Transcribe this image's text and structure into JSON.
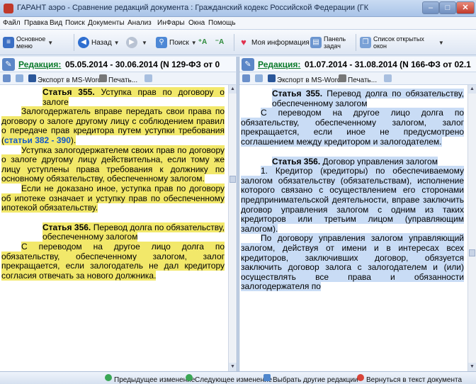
{
  "window": {
    "title": "ГАРАНТ аэро - Сравнение редакций документа : Гражданский кодекс Российской Федерации (ГК РФ) (части перва...",
    "min": "–",
    "max": "□",
    "close": "✕"
  },
  "menu": [
    "Файл",
    "Правка",
    "Вид",
    "Поиск",
    "Документы",
    "Анализ",
    "ИнФары",
    "Окна",
    "Помощь"
  ],
  "toolbar": {
    "main_menu_line1": "Основное",
    "main_menu_line2": "меню",
    "back": "Назад",
    "search": "Поиск",
    "my_info": "Моя информация",
    "panel_line1": "Панель",
    "panel_line2": "задач",
    "windows_line1": "Список открытых",
    "windows_line2": "окон"
  },
  "left": {
    "label": "Редакция:",
    "dates": "05.05.2014 - 30.06.2014 (N 129-ФЗ от 0",
    "export": "Экспорт в MS-Word",
    "print": "Печать...",
    "art355_title": "Статья 355.",
    "art355_name": "Уступка прав по договору о залоге",
    "p1": "Залогодержатель вправе передать свои права по договору о залоге другому лицу с соблюдением правил о передаче прав кредитора путем уступки требования (",
    "p1_link": "статьи 382 - 390",
    "p1_end": ").",
    "p2": "Уступка залогодержателем своих прав по договору о залоге другому лицу действительна, если тому же лицу уступлены права требования к должнику по основному обязательству, обеспеченному залогом.",
    "p3": "Если не доказано иное, уступка прав по договору об ипотеке означает и уступку прав по обеспеченному ипотекой обязательству.",
    "art356_title": "Статья 356.",
    "art356_name": "Перевод долга по обязательству, обеспеченному залогом",
    "p4": "С переводом на другое лицо долга по обязательству, обеспеченному залогом, залог прекращается, если залогодатель не дал кредитору согласия отвечать за нового должника."
  },
  "right": {
    "label": "Редакция:",
    "dates": "01.07.2014 - 31.08.2014 (N 166-ФЗ от 02.1",
    "export": "Экспорт в MS-Word",
    "print": "Печать...",
    "art355_title": "Статья 355.",
    "art355_name": "Перевод долга по обязательству, обеспеченному залогом",
    "p1": "С переводом на другое лицо долга по обязательству, обеспеченному залогом, залог прекращается, если иное не предусмотрено соглашением между кредитором и залогодателем.",
    "art356_title": "Статья 356.",
    "art356_name": "Договор управления залогом",
    "p2": "1. Кредитор (кредиторы) по обеспечиваемому залогом обязательству (обязательствам), исполнение которого связано с осуществлением его сторонами предпринимательской деятельности, вправе заключить договор управления залогом с одним из таких кредиторов или третьим лицом (управляющим залогом).",
    "p3": "По договору управления залогом управляющий залогом, действуя от имени и в интересах всех кредиторов, заключивших договор, обязуется заключить договор залога с залогодателем и (или) осуществлять все права и обязанности залогодержателя по"
  },
  "bottom": {
    "prev": "Предыдущее изменение",
    "next": "Следующее изменение",
    "choose": "Выбрать другие редакции",
    "back_to_doc": "Вернуться в текст документа"
  },
  "colors": {
    "highlight_yellow": "#f2e86a",
    "highlight_blue": "#c9dcf5",
    "label_green": "#0a7a2a",
    "link_blue": "#1559c8"
  }
}
